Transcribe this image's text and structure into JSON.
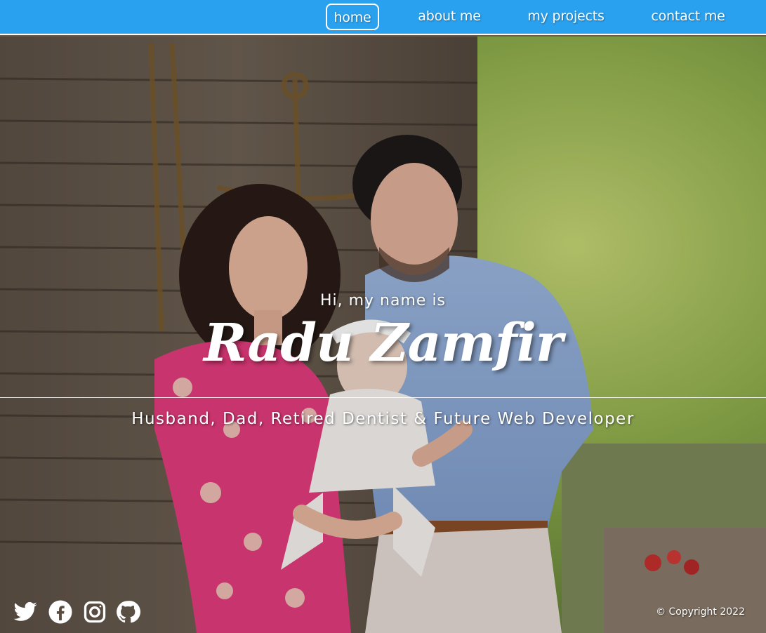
{
  "nav": {
    "items": [
      {
        "label": "home",
        "active": true
      },
      {
        "label": "about me",
        "active": false
      },
      {
        "label": "my projects",
        "active": false
      },
      {
        "label": "contact me",
        "active": false
      }
    ]
  },
  "hero": {
    "greeting": "Hi, my name is",
    "name": "Radu Zamfir",
    "tagline": "Husband, Dad, Retired Dentist & Future Web Developer",
    "image_alt": "family photo"
  },
  "footer": {
    "social_icons": [
      "twitter-icon",
      "facebook-icon",
      "instagram-icon",
      "github-icon"
    ],
    "copyright": "© Copyright 2022"
  },
  "colors": {
    "navbar": "#2aa1ef",
    "text": "#ffffff"
  }
}
